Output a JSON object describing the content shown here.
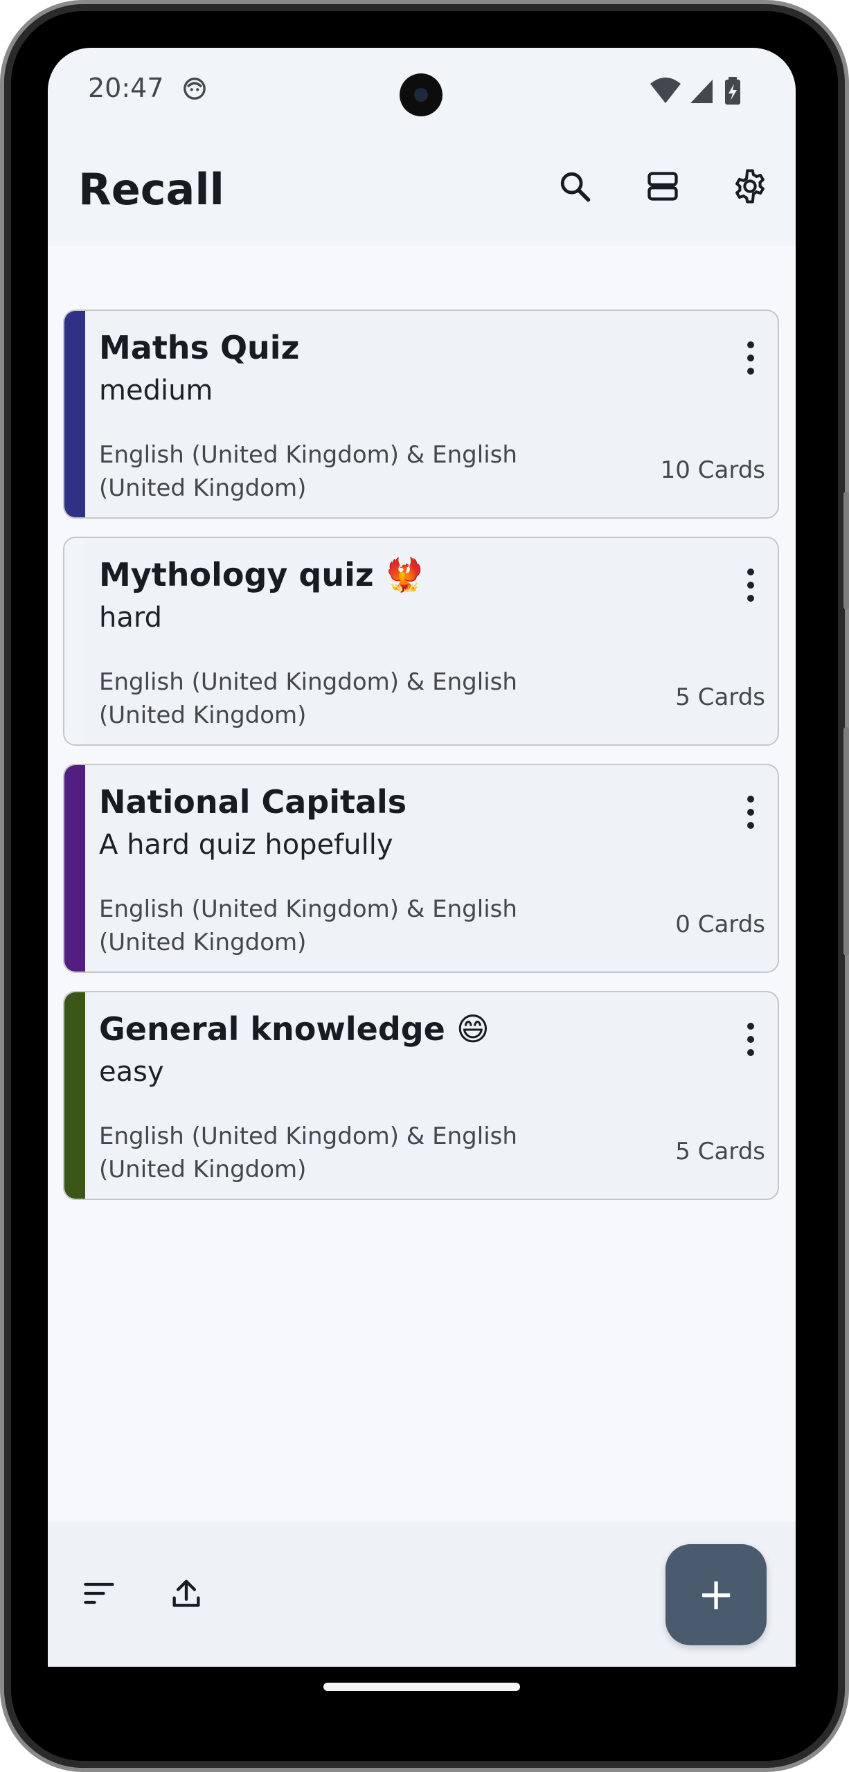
{
  "status_bar": {
    "time": "20:47"
  },
  "app_bar": {
    "title": "Recall",
    "search_icon": "search-icon",
    "view_icon": "view-agenda-icon",
    "settings_icon": "gear-icon"
  },
  "decks": [
    {
      "title": "Maths Quiz",
      "subtitle": "medium",
      "languages": "English (United Kingdom) & English (United Kingdom)",
      "count": "10 Cards",
      "color": "#2f3185"
    },
    {
      "title": "Mythology quiz 🐦‍🔥",
      "subtitle": "hard",
      "languages": "English (United Kingdom) & English (United Kingdom)",
      "count": "5 Cards",
      "color": "#f1f4f8"
    },
    {
      "title": "National Capitals",
      "subtitle": "A hard quiz hopefully",
      "languages": "English (United Kingdom) & English (United Kingdom)",
      "count": "0 Cards",
      "color": "#521e82"
    },
    {
      "title": "General knowledge 😄",
      "subtitle": "easy",
      "languages": "English (United Kingdom) & English (United Kingdom)",
      "count": "5 Cards",
      "color": "#3a5619"
    }
  ],
  "bottom_bar": {
    "sort_icon": "sort-icon",
    "upload_icon": "upload-icon",
    "fab_label": "+"
  }
}
